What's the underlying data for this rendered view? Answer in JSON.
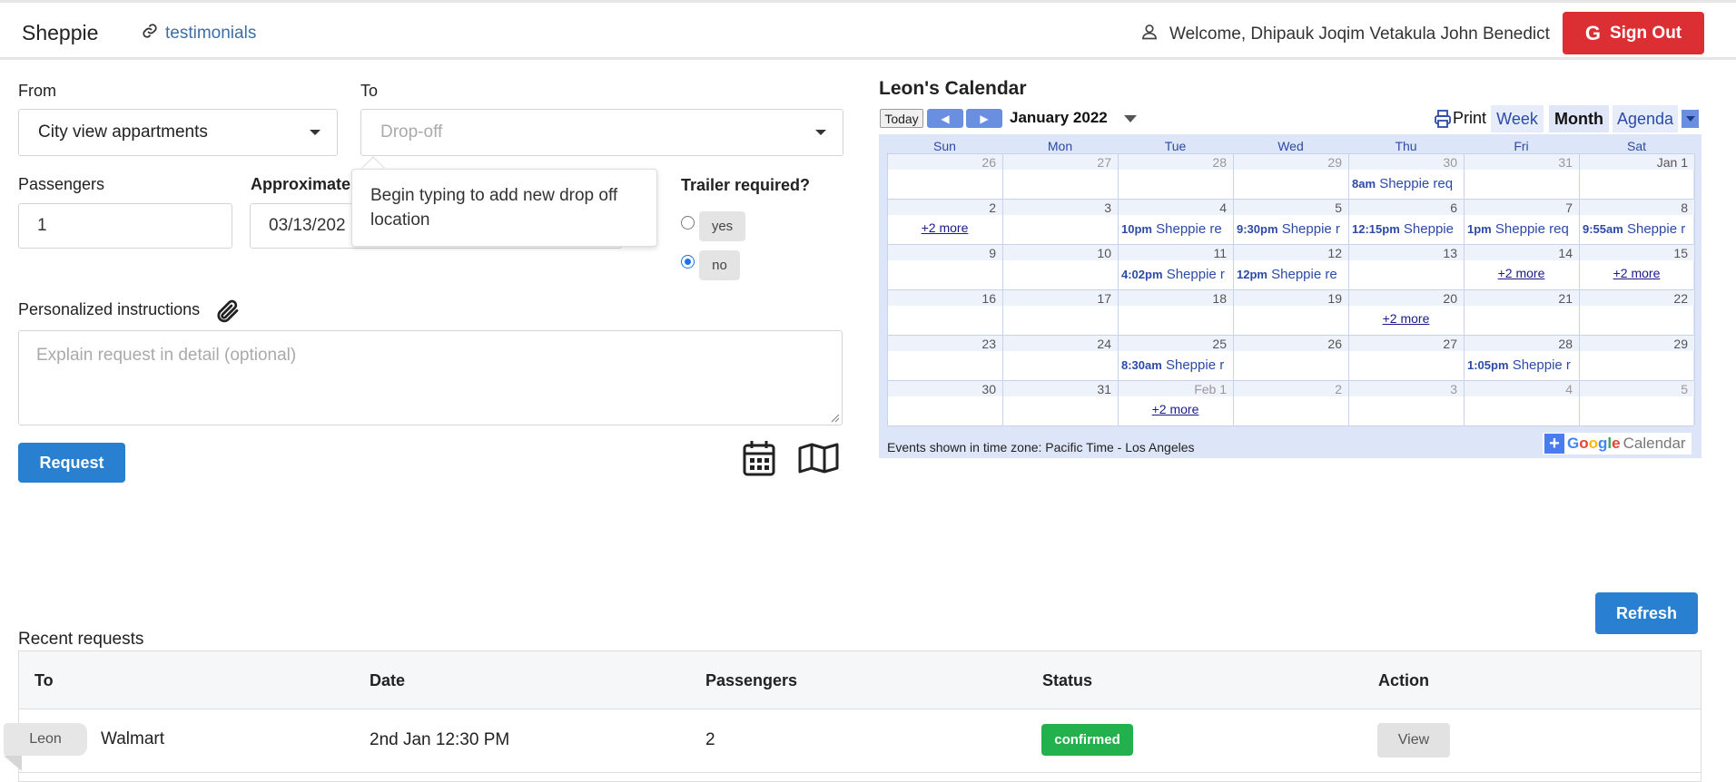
{
  "header": {
    "brand": "Sheppie",
    "testimonials": "testimonials",
    "welcome": "Welcome, Dhipauk Joqim Vetakula John Benedict",
    "signout": "Sign Out"
  },
  "form": {
    "from_label": "From",
    "from_value": "City view appartments",
    "to_label": "To",
    "to_placeholder": "Drop-off",
    "passengers_label": "Passengers",
    "passengers_value": "1",
    "approx_label": "Approximate t",
    "date_value": "03/13/202",
    "trailer_label": "Trailer required?",
    "trailer_yes": "yes",
    "trailer_no": "no",
    "tooltip": "Begin typing to add new drop off location",
    "instructions_label": "Personalized instructions",
    "instructions_placeholder": "Explain request in detail (optional)",
    "request_button": "Request"
  },
  "calendar": {
    "title": "Leon's Calendar",
    "today": "Today",
    "month": "January 2022",
    "print": "Print",
    "tabs": [
      "Week",
      "Month",
      "Agenda"
    ],
    "days_of_week": [
      "Sun",
      "Mon",
      "Tue",
      "Wed",
      "Thu",
      "Fri",
      "Sat"
    ],
    "weeks": [
      [
        "26",
        "27",
        "28",
        "29",
        "30",
        "31",
        "Jan 1"
      ],
      [
        "2",
        "3",
        "4",
        "5",
        "6",
        "7",
        "8"
      ],
      [
        "9",
        "10",
        "11",
        "12",
        "13",
        "14",
        "15"
      ],
      [
        "16",
        "17",
        "18",
        "19",
        "20",
        "21",
        "22"
      ],
      [
        "23",
        "24",
        "25",
        "26",
        "27",
        "28",
        "29"
      ],
      [
        "30",
        "31",
        "Feb 1",
        "2",
        "3",
        "4",
        "5"
      ]
    ],
    "events": [
      {
        "time": "8am",
        "title": "Sheppie req"
      },
      {
        "time": "10pm",
        "title": "Sheppie re"
      },
      {
        "time": "9:30pm",
        "title": "Sheppie r"
      },
      {
        "time": "12:15pm",
        "title": "Sheppie"
      },
      {
        "time": "1pm",
        "title": "Sheppie req"
      },
      {
        "time": "9:55am",
        "title": "Sheppie r"
      },
      {
        "time": "4:02pm",
        "title": "Sheppie r"
      },
      {
        "time": "12pm",
        "title": "Sheppie re"
      },
      {
        "time": "8:30am",
        "title": "Sheppie r"
      },
      {
        "time": "1:05pm",
        "title": "Sheppie r"
      }
    ],
    "more": "+2 more",
    "timezone": "Events shown in time zone: Pacific Time - Los Angeles",
    "google": "Google",
    "google_cal": "Calendar"
  },
  "requests": {
    "refresh": "Refresh",
    "title": "Recent requests",
    "columns": [
      "To",
      "Date",
      "Passengers",
      "Status",
      "Action"
    ],
    "rows": [
      {
        "tag": "Leon",
        "to": "Walmart",
        "date": "2nd Jan 12:30 PM",
        "passengers": "2",
        "status": "confirmed",
        "action": "View"
      }
    ]
  }
}
